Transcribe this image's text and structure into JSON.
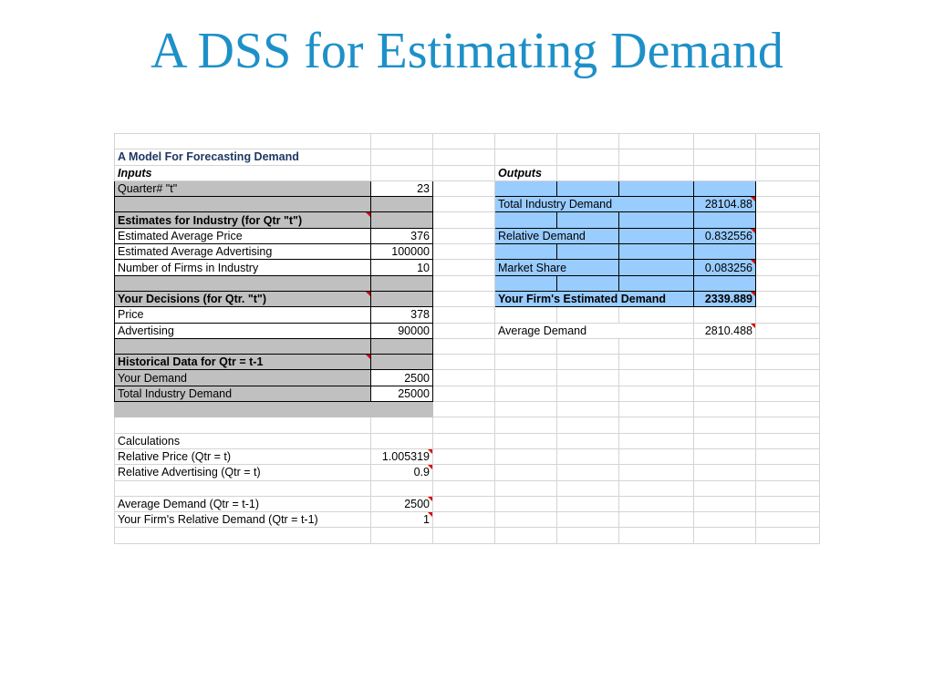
{
  "slide": {
    "title": "A DSS for Estimating Demand"
  },
  "sheet": {
    "model_title": "A Model For Forecasting Demand",
    "inputs_header": "Inputs",
    "outputs_header": "Outputs",
    "quarter_label": "Quarter#  \"t\"",
    "quarter_value": "23",
    "industry_header": "Estimates for Industry (for Qtr \"t\")",
    "avg_price_label": "Estimated Average Price",
    "avg_price_value": "376",
    "avg_adv_label": "Estimated Average Advertising",
    "avg_adv_value": "100000",
    "num_firms_label": "Number of Firms in Industry",
    "num_firms_value": "10",
    "decisions_header": "Your Decisions (for Qtr. \"t\")",
    "price_label": "Price",
    "price_value": "378",
    "advertising_label": "Advertising",
    "advertising_value": "90000",
    "historical_header": "Historical Data for Qtr = t-1",
    "your_demand_label": "Your Demand",
    "your_demand_value": "2500",
    "total_demand_hist_label": "Total Industry Demand",
    "total_demand_hist_value": "25000",
    "calculations_label": "Calculations",
    "rel_price_label": "Relative Price (Qtr = t)",
    "rel_price_value": "1.005319",
    "rel_adv_label": "Relative Advertising (Qtr = t)",
    "rel_adv_value": "0.9",
    "avg_demand_prev_label": "Average Demand (Qtr = t-1)",
    "avg_demand_prev_value": "2500",
    "rel_demand_prev_label": "Your Firm's Relative Demand (Qtr = t-1)",
    "rel_demand_prev_value": "1",
    "out_total_demand_label": "Total Industry Demand",
    "out_total_demand_value": "28104.88",
    "out_rel_demand_label": "Relative Demand",
    "out_rel_demand_value": "0.832556",
    "out_market_share_label": "Market Share",
    "out_market_share_value": "0.083256",
    "out_est_demand_label": "Your Firm's Estimated Demand",
    "out_est_demand_value": "2339.889",
    "out_avg_demand_label": "Average Demand",
    "out_avg_demand_value": "2810.488"
  },
  "colors": {
    "title": "#1e90c8",
    "input_fill": "#c0c0c0",
    "output_fill": "#99ccff",
    "comment_marker": "#e00000"
  }
}
